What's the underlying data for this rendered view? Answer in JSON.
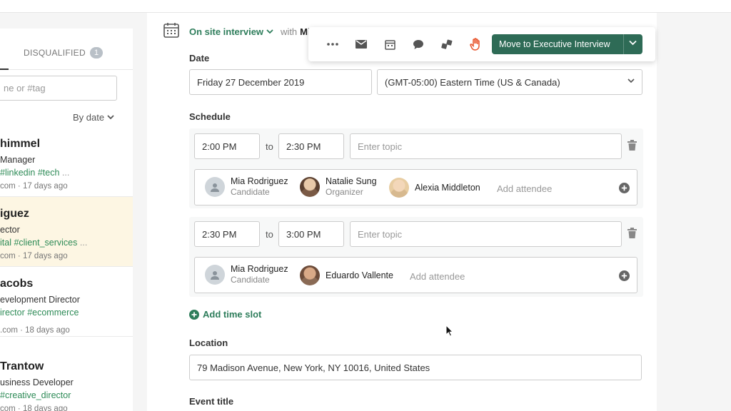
{
  "left": {
    "tab_disqualified": "DISQUALIFIED",
    "disqualified_count": "1",
    "search_placeholder": "ne or #tag",
    "sort_label": "By date",
    "candidates": [
      {
        "name": "himmel",
        "role": "Manager",
        "tags": "#linkedin #tech",
        "more": "...",
        "meta": "com · 17 days ago"
      },
      {
        "name": "iguez",
        "role": "ector",
        "tags": "ital #client_services",
        "more": "...",
        "meta": "com · 17 days ago"
      },
      {
        "name": "acobs",
        "role": "evelopment Director",
        "tags": "irector #ecommerce",
        "more": "",
        "meta": ".com · 18 days ago"
      },
      {
        "name": "Trantow",
        "role": "usiness Developer",
        "tags": "#creative_director",
        "more": "",
        "meta": "com · 18 days ago"
      }
    ]
  },
  "header": {
    "event_type": "On site interview",
    "with_label": "with",
    "with_name": "Mi"
  },
  "toolbar": {
    "move_label": "Move to Executive Interview",
    "icons": [
      "more-icon",
      "mail-icon",
      "calendar-icon",
      "comment-icon",
      "transfer-icon",
      "hand-icon"
    ]
  },
  "form": {
    "date_label": "Date",
    "date_value": "Friday 27 December 2019",
    "timezone_value": "(GMT-05:00) Eastern Time (US & Canada)",
    "schedule_label": "Schedule",
    "to_label": "to",
    "topic_placeholder": "Enter topic",
    "add_attendee": "Add attendee",
    "slots": [
      {
        "start": "2:00 PM",
        "end": "2:30 PM",
        "attendees": [
          {
            "name": "Mia Rodriguez",
            "role": "Candidate"
          },
          {
            "name": "Natalie Sung",
            "role": "Organizer"
          },
          {
            "name": "Alexia Middleton",
            "role": ""
          }
        ]
      },
      {
        "start": "2:30 PM",
        "end": "3:00 PM",
        "attendees": [
          {
            "name": "Mia Rodriguez",
            "role": "Candidate"
          },
          {
            "name": "Eduardo Vallente",
            "role": ""
          }
        ]
      }
    ],
    "add_time_slot": "Add time slot",
    "location_label": "Location",
    "location_value": "79 Madison Avenue, New York, NY 10016, United States",
    "event_title_label": "Event title"
  },
  "colors": {
    "brand_green": "#2e7d5b",
    "button_green": "#2e6b56",
    "hand_orange": "#e8542b",
    "selected_row": "#fdf6e3"
  }
}
